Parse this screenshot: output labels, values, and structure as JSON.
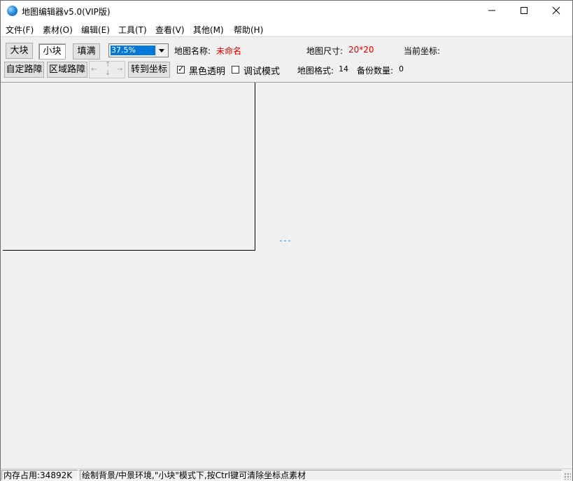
{
  "window": {
    "title": "地图编辑器v5.0(VIP版)",
    "minimize_glyph": "—",
    "maximize_glyph": "☐",
    "close_glyph": "✕"
  },
  "menu": [
    "文件(F)",
    "素材(O)",
    "编辑(E)",
    "工具(T)",
    "查看(V)",
    "其他(M)",
    "帮助(H)"
  ],
  "toolbar": {
    "large_block": "大块",
    "small_block": "小块",
    "fill": "填满",
    "zoom_value": "37.5%",
    "map_name_label": "地图名称:",
    "map_name_value": "未命名",
    "map_size_label": "地图尺寸:",
    "map_size_value": "20*20",
    "current_coord_label": "当前坐标:",
    "custom_obstacle": "自定路障",
    "area_obstacle": "区域路障",
    "goto_coord": "转到坐标",
    "black_transparent": "黑色透明",
    "black_transparent_checked": true,
    "debug_mode": "调试模式",
    "debug_mode_checked": false,
    "map_format_label": "地图格式:",
    "map_format_value": "14",
    "backup_count_label": "备份数量:",
    "backup_count_value": "0"
  },
  "status": {
    "memory": "内存占用:34892K",
    "hint": "绘制背景/中景环境,\"小块\"模式下,按Ctrl键可清除坐标点素材"
  },
  "colors": {
    "accent": "#0078d7",
    "value_red": "#d40000"
  }
}
